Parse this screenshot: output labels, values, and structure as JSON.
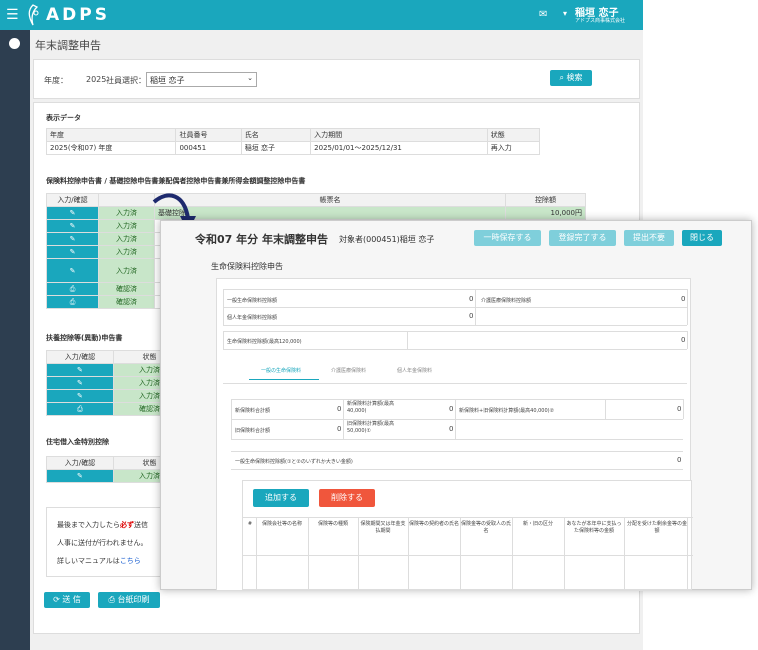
{
  "app": {
    "logo_text": "ADPS",
    "user_name": "稲垣 恋子",
    "user_company": "アドプス商事株式会社",
    "accent_color": "#1aa7bd",
    "sidebar_color": "#2d3e50"
  },
  "page": {
    "title": "年末調整申告"
  },
  "filter": {
    "year_label": "年度：",
    "year_value": "2025",
    "employee_label": "社員選択：",
    "employee_value": "稲垣 恋子",
    "search_button": "検索"
  },
  "display": {
    "title": "表示データ",
    "headers": [
      "年度",
      "社員番号",
      "氏名",
      "入力期間",
      "状態"
    ],
    "row": [
      "2025(令和07) 年度",
      "000451",
      "稲垣 恋子",
      "2025/01/01～2025/12/31",
      "再入力"
    ]
  },
  "insurance_section": {
    "title": "保険料控除申告書 / 基礎控除申告書兼配偶者控除申告書兼所得金額調整控除申告書",
    "col_input": "入力/確認",
    "col_form": "帳票名",
    "col_amount": "控除額",
    "first_form": "基礎控除",
    "first_amount": "10,000円",
    "statuses": [
      "入力済",
      "入力済",
      "入力済",
      "入力済",
      "入力済",
      "確認済",
      "確認済"
    ]
  },
  "dependent_section": {
    "title": "扶養控除等(異動)申告書",
    "col_input": "入力/確認",
    "col_status": "状態",
    "statuses": [
      "入力済",
      "入力済",
      "入力済",
      "確認済"
    ]
  },
  "housing_section": {
    "title": "住宅借入金特別控除",
    "col_input": "入力/確認",
    "col_status": "状態",
    "statuses": [
      "入力済"
    ]
  },
  "notice": {
    "line1_pre": "最後まで入力したら",
    "line1_must": "必ず",
    "line1_post": "送信",
    "line2": "人事に送付が行われません。",
    "line3_pre": "詳しいマニュアルは",
    "line3_link": "こちら"
  },
  "bottom_buttons": {
    "send": "送 信",
    "print": "台紙印刷"
  },
  "modal": {
    "title": "令和07 年分 年末調整申告",
    "subject": "対象者(000451)稲垣 恋子",
    "btn_save": "一時保存する",
    "btn_register": "登録完了する",
    "btn_no_submit": "提出不要",
    "btn_close": "閉じる",
    "heading": "生命保険料控除申告",
    "general_label": "一般生命保険料控除額",
    "general_value": "0",
    "care_label": "介護医療保険料控除額",
    "care_value": "0",
    "pension_label": "個人年金保険料控除額",
    "pension_value": "0",
    "total_label": "生命保険料控除額(最高120,000)",
    "total_value": "0",
    "tabs": [
      "一般の生命保険料",
      "介護医療保険料",
      "個人年金保険料"
    ],
    "new_total_label": "新保険料合計額",
    "new_total_value": "0",
    "new_calc_label": "新保険料計算額(最高40,000)",
    "new_calc_value": "0",
    "combined_label": "新保険料+旧保険料計算額(最高40,000)②",
    "combined_value": "0",
    "old_total_label": "旧保険料合計額",
    "old_total_value": "0",
    "old_calc_label": "旧保険料計算額(最高50,000)①",
    "old_calc_value": "0",
    "general_deduction_label": "一般生命保険料控除額(①と②のいずれか大きい金額)",
    "general_deduction_value": "0",
    "btn_add": "追加する",
    "btn_delete": "削除する",
    "columns": [
      "#",
      "保険会社等の名称",
      "保険等の種類",
      "保険期間又は年金支払期間",
      "保険等の契約者の氏名",
      "保険金等の受取人の氏名",
      "新・旧の区分",
      "あなたが本年中に支払った保険料等の金額",
      "分配を受けた剰余金等の金額"
    ]
  }
}
